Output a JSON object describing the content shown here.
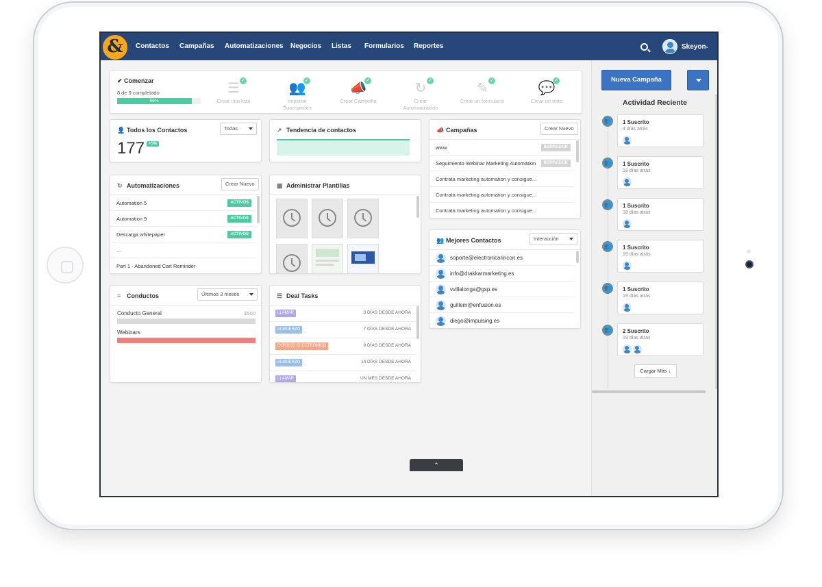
{
  "nav": {
    "logo": "&",
    "items": [
      "Contactos",
      "Campañas",
      "Automatizaciones",
      "Negocios",
      "Listas",
      "Formularios",
      "Reportes"
    ],
    "user": "Skeyon"
  },
  "onboarding": {
    "title": "Comenzar",
    "subtitle": "8 de 9 completado",
    "progress_label": "89%",
    "progress_value": 0.89,
    "steps": [
      {
        "label": "Crear una lista",
        "icon": "list-icon"
      },
      {
        "label": "Importar Suscriptores",
        "icon": "users-icon"
      },
      {
        "label": "Crear Campaña",
        "icon": "megaphone-icon"
      },
      {
        "label": "Crear Automatización",
        "icon": "refresh-icon"
      },
      {
        "label": "Crear un formulario",
        "icon": "pencil-icon"
      },
      {
        "label": "Crear un trato",
        "icon": "chat-icon"
      }
    ]
  },
  "contacts_card": {
    "title": "Todos los Contactos",
    "filter": "Todas",
    "count": "177",
    "delta": "+5%"
  },
  "trend_card": {
    "title": "Tendencia de contactos"
  },
  "campaigns_card": {
    "title": "Campañas",
    "button": "Crear Nuevo",
    "rows": [
      {
        "name": "www",
        "tag": "BORRADOR"
      },
      {
        "name": "Seguimiento Webinar Marketing Automation",
        "tag": "BORRADOR"
      },
      {
        "name": "Contrata marketing automation y consigue...",
        "tag": ""
      },
      {
        "name": "Contrata marketing automation y consigue...",
        "tag": ""
      },
      {
        "name": "Contrata marketing automation y consigue...",
        "tag": ""
      }
    ]
  },
  "automations_card": {
    "title": "Automatizaciones",
    "button": "Crear Nuevo",
    "rows": [
      {
        "name": "Automation 5",
        "tag": "ACTIVOS"
      },
      {
        "name": "Automation 9",
        "tag": "ACTIVOS"
      },
      {
        "name": "Descarga whitepaper",
        "tag": "ACTIVOS"
      },
      {
        "name": "...",
        "tag": ""
      },
      {
        "name": "Part 1 - Abandoned Cart Reminder",
        "tag": ""
      }
    ]
  },
  "templates_card": {
    "title": "Administrar Plantillas"
  },
  "top_contacts_card": {
    "title": "Mejores Contactos",
    "filter": "Interacción",
    "rows": [
      "soporte@electronicarincon.es",
      "info@drakkarmarketing.es",
      "vvillalonga@gsp.es",
      "guillem@enfusion.es",
      "diego@impulsing.es"
    ]
  },
  "pipelines_card": {
    "title": "Conductos",
    "filter": "Últimos 3 meses",
    "rows": [
      {
        "name": "Conducto General",
        "value": "$500",
        "color": "#d9d9d9"
      },
      {
        "name": "Webinars",
        "value": "",
        "color": "#ef8080"
      }
    ]
  },
  "deal_tasks_card": {
    "title": "Deal Tasks",
    "rows": [
      {
        "type": "LLAMAR",
        "when": "3 DÍAS DESDE AHORA",
        "color": "#b1a9e0"
      },
      {
        "type": "ALMUERZO",
        "when": "7 DÍAS DESDE AHORA",
        "color": "#9dbde8"
      },
      {
        "type": "CORREO ELECTRÓNICO",
        "when": "9 DÍAS DESDE AHORA",
        "color": "#f2a98a"
      },
      {
        "type": "ALMUERZO",
        "when": "14 DÍAS DESDE AHORA",
        "color": "#9dbde8"
      },
      {
        "type": "LLAMAR",
        "when": "UN MES DESDE AHORA",
        "color": "#b1a9e0"
      }
    ]
  },
  "sidebar": {
    "primary_button": "Nueva Campaña",
    "title": "Actividad Reciente",
    "activities": [
      {
        "title": "1 Suscrito",
        "when": "4 días atrás",
        "avatars": 1
      },
      {
        "title": "1 Suscrito",
        "when": "18 días atrás",
        "avatars": 1
      },
      {
        "title": "1 Suscrito",
        "when": "18 días atrás",
        "avatars": 1
      },
      {
        "title": "1 Suscrito",
        "when": "19 días atrás",
        "avatars": 1
      },
      {
        "title": "1 Suscrito",
        "when": "19 días atrás",
        "avatars": 1
      },
      {
        "title": "2 Suscrito",
        "when": "19 días atrás",
        "avatars": 2
      }
    ],
    "load_more": "Cargar Más"
  },
  "colors": {
    "nav": "#27477a",
    "accent": "#3b74c2",
    "success": "#4ccaa0",
    "logo": "#f5a81c"
  }
}
